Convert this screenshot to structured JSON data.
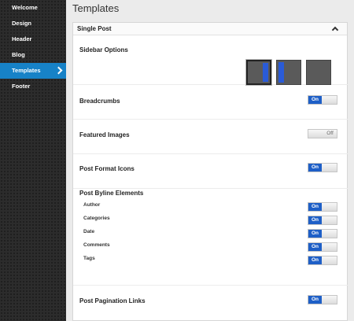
{
  "sidebar": {
    "items": [
      {
        "label": "Welcome"
      },
      {
        "label": "Design"
      },
      {
        "label": "Header"
      },
      {
        "label": "Blog"
      },
      {
        "label": "Templates"
      },
      {
        "label": "Footer"
      }
    ],
    "active": "Templates"
  },
  "page": {
    "title": "Templates"
  },
  "panel": {
    "title": "Single Post",
    "sidebar_options": {
      "label": "Sidebar Options",
      "selected": "left-sidebar"
    },
    "breadcrumbs": {
      "label": "Breadcrumbs",
      "state": "On"
    },
    "featured_images": {
      "label": "Featured Images",
      "state": "Off"
    },
    "post_format_icons": {
      "label": "Post Format Icons",
      "state": "On"
    },
    "byline": {
      "label": "Post Byline Elements",
      "items": [
        {
          "label": "Author",
          "state": "On"
        },
        {
          "label": "Categories",
          "state": "On"
        },
        {
          "label": "Date",
          "state": "On"
        },
        {
          "label": "Comments",
          "state": "On"
        },
        {
          "label": "Tags",
          "state": "On"
        }
      ]
    },
    "pagination": {
      "label": "Post Pagination Links",
      "state": "On"
    }
  },
  "colors": {
    "accent": "#1782c7",
    "toggle_on": "#1e5fc7",
    "sidebar_bg": "#2c2c2c"
  },
  "icons": {
    "collapse": "chevron-up-icon",
    "active_nav": "chevron-right-icon"
  }
}
